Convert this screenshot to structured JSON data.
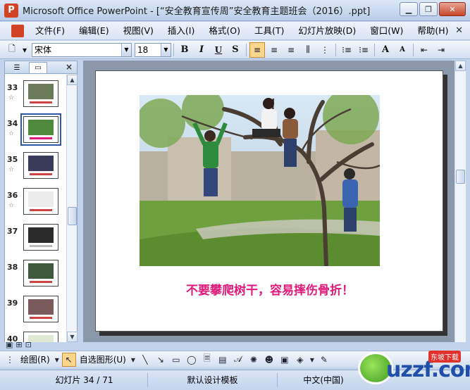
{
  "window": {
    "title": "Microsoft Office PowerPoint - [“安全教育宣传周”安全教育主题班会（2016）.ppt]",
    "app_icon": "powerpoint-icon"
  },
  "menu": {
    "items": [
      "文件(F)",
      "编辑(E)",
      "视图(V)",
      "插入(I)",
      "格式(O)",
      "工具(T)",
      "幻灯片放映(D)",
      "窗口(W)",
      "帮助(H)"
    ]
  },
  "format_toolbar": {
    "font_name": "宋体",
    "font_size": "18",
    "bold": "B",
    "italic": "I",
    "underline": "U",
    "shadow": "S",
    "grow_font": "A",
    "shrink_font": "A"
  },
  "left_pane": {
    "tabs": [
      "outline-tab",
      "slides-tab"
    ],
    "close": "×",
    "thumbnails": [
      {
        "num": "33",
        "star": "☆",
        "selected": false
      },
      {
        "num": "34",
        "star": "☆",
        "selected": true
      },
      {
        "num": "35",
        "star": "☆",
        "selected": false
      },
      {
        "num": "36",
        "star": "☆",
        "selected": false
      },
      {
        "num": "37",
        "star": "",
        "selected": false
      },
      {
        "num": "38",
        "star": "",
        "selected": false
      },
      {
        "num": "39",
        "star": "",
        "selected": false
      },
      {
        "num": "40",
        "star": "",
        "selected": false
      }
    ]
  },
  "slide": {
    "caption": "不要攀爬树干，容易摔伤骨折！",
    "caption_color": "#e0197a"
  },
  "draw_toolbar": {
    "draw_label": "绘图(R)",
    "autoshapes_label": "自选图形(U)"
  },
  "status": {
    "slide_position": "幻灯片 34 / 71",
    "design": "默认设计模板",
    "language": "中文(中国)"
  },
  "watermark": {
    "text": "uzzf.com",
    "badge": "东坡下载"
  },
  "colors": {
    "titlebar": "#c9d9ef",
    "accent_selected": "#fbd68b",
    "slide_bg": "#8b98ac"
  }
}
